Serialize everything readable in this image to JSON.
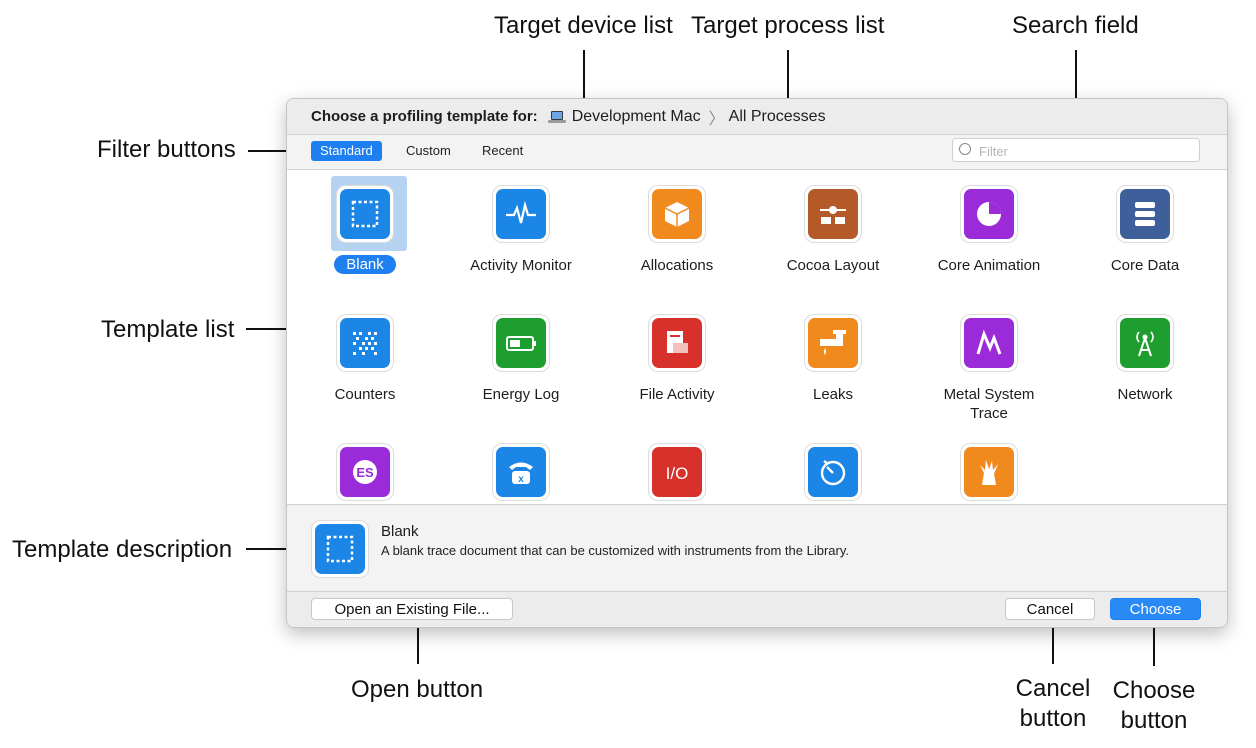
{
  "callouts": {
    "target_device_list": "Target device list",
    "target_process_list": "Target process list",
    "search_field": "Search field",
    "filter_buttons": "Filter buttons",
    "template_list": "Template list",
    "template_description": "Template description",
    "open_button": "Open button",
    "cancel_button_line1": "Cancel",
    "cancel_button_line2": "button",
    "choose_button_line1": "Choose",
    "choose_button_line2": "button"
  },
  "titlebar": {
    "title": "Choose a profiling template for:",
    "device": "Development Mac",
    "process": "All Processes"
  },
  "filters": {
    "standard": "Standard",
    "custom": "Custom",
    "recent": "Recent",
    "active": "Standard"
  },
  "search": {
    "placeholder": "Filter"
  },
  "templates": [
    {
      "label": "Blank",
      "icon": "blank-icon",
      "color": "#1b86e6",
      "selected": true
    },
    {
      "label": "Activity Monitor",
      "icon": "activity-monitor-icon",
      "color": "#1b86e6"
    },
    {
      "label": "Allocations",
      "icon": "allocations-icon",
      "color": "#f08a1c"
    },
    {
      "label": "Cocoa Layout",
      "icon": "cocoa-layout-icon",
      "color": "#b45a28"
    },
    {
      "label": "Core Animation",
      "icon": "core-animation-icon",
      "color": "#9b2ad8"
    },
    {
      "label": "Core Data",
      "icon": "core-data-icon",
      "color": "#3f5f9a"
    },
    {
      "label": "Counters",
      "icon": "counters-icon",
      "color": "#1b86e6"
    },
    {
      "label": "Energy Log",
      "icon": "energy-log-icon",
      "color": "#1e9e2e"
    },
    {
      "label": "File Activity",
      "icon": "file-activity-icon",
      "color": "#d8302a"
    },
    {
      "label": "Leaks",
      "icon": "leaks-icon",
      "color": "#f08a1c"
    },
    {
      "label": "Metal System Trace",
      "icon": "metal-system-trace-icon",
      "color": "#9b2ad8"
    },
    {
      "label": "Network",
      "icon": "network-icon",
      "color": "#1e9e2e"
    },
    {
      "label": "",
      "icon": "opengl-es-icon",
      "color": "#9b2ad8"
    },
    {
      "label": "",
      "icon": "system-usage-icon",
      "color": "#1b86e6"
    },
    {
      "label": "",
      "icon": "io-activity-icon",
      "color": "#d8302a"
    },
    {
      "label": "",
      "icon": "time-profiler-icon",
      "color": "#1b86e6"
    },
    {
      "label": "",
      "icon": "zombies-icon",
      "color": "#f08a1c"
    }
  ],
  "description": {
    "title": "Blank",
    "text": "A blank trace document that can be customized with instruments from the Library."
  },
  "buttons": {
    "open": "Open an Existing File...",
    "cancel": "Cancel",
    "choose": "Choose"
  }
}
